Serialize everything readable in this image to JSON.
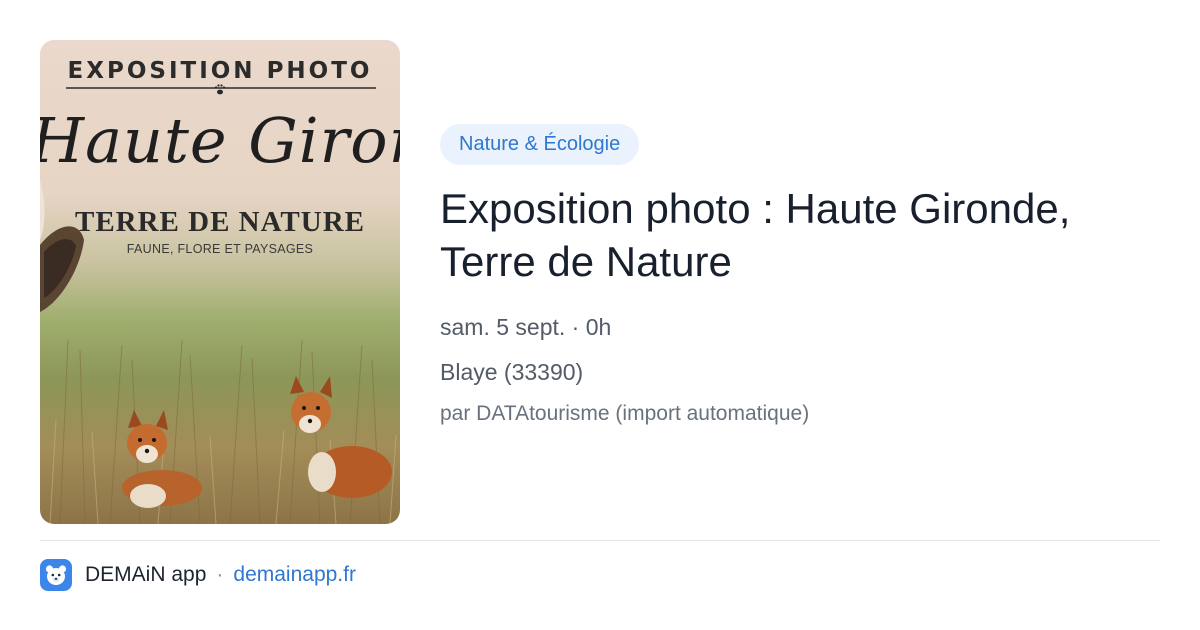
{
  "poster": {
    "header": "EXPOSITION PHOTO",
    "script_title": "Haute Gironde",
    "subtitle": "TERRE DE NATURE",
    "tagline": "FAUNE, FLORE ET PAYSAGES",
    "alt": "Exposition photo : Haute Gironde, Terre de Nature"
  },
  "event": {
    "category": "Nature & Écologie",
    "title": "Exposition photo : Haute Gironde, Terre de Nature",
    "date": "sam. 5 sept. · 0h",
    "location": "Blaye (33390)",
    "source": "par DATAtourisme (import automatique)"
  },
  "footer": {
    "app_icon": "bear-app-icon",
    "app_name": "DEMAiN app",
    "separator": "·",
    "domain": "demainapp.fr"
  },
  "colors": {
    "accent": "#2f77cf",
    "badge_bg": "#eaf3fd",
    "title": "#18202e",
    "meta": "#535b66"
  }
}
